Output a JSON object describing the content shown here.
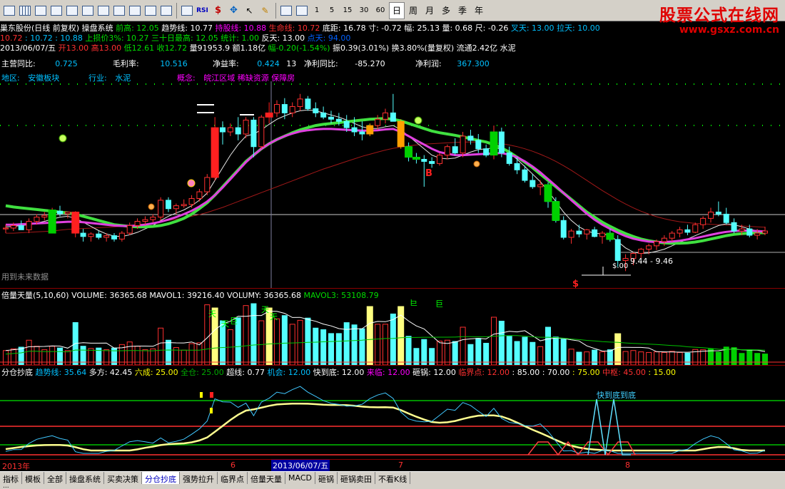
{
  "toolbar": {
    "period_buttons": [
      "1",
      "5",
      "15",
      "30",
      "60"
    ],
    "day_label": "日",
    "week_label": "周",
    "month_label": "月",
    "multi_label": "多",
    "season_label": "季",
    "year_label": "年"
  },
  "logo": {
    "title": "股票公式在线网",
    "url": "www.gsxz.com.cn"
  },
  "header": {
    "line1": [
      {
        "t": "巢东股份(日线 前复权) 操盘系统",
        "c": "#ffffff"
      },
      {
        "t": " 前高: 12.05",
        "c": "#00dd00"
      },
      {
        "t": "  趋势线: 10.77",
        "c": "#ffffff"
      },
      {
        "t": "  持股线: 10.88",
        "c": "#ff00ff"
      },
      {
        "t": "  生命线: 10.72",
        "c": "#ff3030"
      },
      {
        "t": "  底距: 16.78",
        "c": "#ffffff"
      },
      {
        "t": "  寸: -0.72",
        "c": "#ffffff"
      },
      {
        "t": "  幅: 25.13",
        "c": "#ffffff"
      },
      {
        "t": "  量: 0.68",
        "c": "#ffffff"
      },
      {
        "t": "  尺: -0.26",
        "c": "#ffffff"
      },
      {
        "t": "  叉天: 13.00",
        "c": "#00c0ff"
      },
      {
        "t": "  拉天: 10.00",
        "c": "#00c0ff"
      }
    ],
    "line2": [
      {
        "t": "  10.72",
        "c": "#ff3030"
      },
      {
        "t": " : 10.72",
        "c": "#00c0ff"
      },
      {
        "t": " : 10.88",
        "c": "#00c0ff"
      },
      {
        "t": "                               上损价3%: 10.27",
        "c": "#00dd00"
      },
      {
        "t": "  三十日最高: 12.05",
        "c": "#00dd00"
      },
      {
        "t": "  统计: 1.00",
        "c": "#00dd00"
      },
      {
        "t": "  反天: 13.00",
        "c": "#ffffff"
      },
      {
        "t": "  点天: 94.00",
        "c": "#0060ff"
      }
    ],
    "line3": [
      {
        "t": "2013/06/07/五",
        "c": "#ffffff"
      },
      {
        "t": " 开13.00",
        "c": "#ff3030"
      },
      {
        "t": " 高13.00",
        "c": "#ff3030"
      },
      {
        "t": " 低12.61",
        "c": "#00dd00"
      },
      {
        "t": " 收12.72",
        "c": "#00dd00"
      },
      {
        "t": " 量91953.9",
        "c": "#ffffff"
      },
      {
        "t": " 额1.18亿",
        "c": "#ffffff"
      },
      {
        "t": " 幅-0.20(-1.54%)",
        "c": "#00dd00"
      },
      {
        "t": " 振0.39(3.01%)",
        "c": "#ffffff"
      },
      {
        "t": " 换3.80%(量复权)",
        "c": "#ffffff"
      },
      {
        "t": " 流通2.42亿",
        "c": "#ffffff"
      },
      {
        "t": " 水泥",
        "c": "#ffffff"
      }
    ]
  },
  "fundamentals": {
    "row1": [
      {
        "label": "主营同比:",
        "value": "0.725"
      },
      {
        "label": "毛利率:",
        "value": "10.516"
      },
      {
        "label": "净益率:",
        "value": "0.424"
      },
      {
        "label": "净利同比:",
        "value": "-85.270"
      },
      {
        "label": "净利润:",
        "value": "367.300"
      }
    ],
    "mid_label": "13",
    "area_label": "地区:",
    "area_value": "安徽板块",
    "industry_label": "行业:",
    "industry_value": "水泥",
    "concept_label": "概念:",
    "concept_value": "皖江区域 稀缺资源 保障房"
  },
  "chart": {
    "b_label": "B",
    "s_label": "$",
    "s_price": "$.00",
    "range_label": "9.44 - 9.46",
    "future_label": "用到未来数据"
  },
  "volume": {
    "header": [
      {
        "t": "倍量天量(5,10,60)",
        "c": "#ffffff"
      },
      {
        "t": "  VOLUME: 36365.68",
        "c": "#ffffff"
      },
      {
        "t": "  MAVOL1: 39216.40",
        "c": "#ffffff"
      },
      {
        "t": "  VOLUMY: 36365.68",
        "c": "#ffffff"
      },
      {
        "t": "   MAVOL3: 53108.79",
        "c": "#00dd00"
      }
    ],
    "marks": [
      "天",
      "天",
      "巨",
      "天",
      "天",
      "巨",
      "巨"
    ]
  },
  "indicator": {
    "header": [
      {
        "t": "分仓抄底",
        "c": "#ffffff"
      },
      {
        "t": "  趋势线: 35.64",
        "c": "#00c0ff"
      },
      {
        "t": "     多方: 42.45",
        "c": "#ffffff"
      },
      {
        "t": "  六成: 25.00",
        "c": "#ffff00"
      },
      {
        "t": "  全仓: 25.00",
        "c": "#00aa00"
      },
      {
        "t": "      超线: 0.77",
        "c": "#ffffff"
      },
      {
        "t": "  机会: 12.00",
        "c": "#00c0ff"
      },
      {
        "t": "  快到底: 12.00",
        "c": "#ffffff"
      },
      {
        "t": "  来临: 12.00",
        "c": "#ff00ff"
      },
      {
        "t": "   砸锅: 12.00",
        "c": "#ffffff"
      },
      {
        "t": "   临界点: 12.00",
        "c": "#ff3030"
      },
      {
        "t": " : 85.00",
        "c": "#ffffff"
      },
      {
        "t": " : 70.00",
        "c": "#ffffff"
      },
      {
        "t": " : 75.00",
        "c": "#ffff00"
      },
      {
        "t": "  中枢: 45.00",
        "c": "#ff3030"
      },
      {
        "t": " : 15.00",
        "c": "#ffff00"
      }
    ],
    "bottom_label": "快到底到底"
  },
  "date_axis": {
    "year_label": "2013年",
    "m6": "6",
    "current": "2013/06/07/五",
    "m7": "7",
    "m8": "8"
  },
  "tabs": [
    "指标",
    "模板",
    "全部",
    "操盘系统",
    "买卖决策",
    "分仓抄底",
    "强势拉升",
    "临界点",
    "倍量天量",
    "MACD",
    "砸锅",
    "砸锅卖田",
    "不看K线"
  ],
  "active_tab": 5,
  "bottom_strip": "...",
  "chart_data": {
    "type": "candlestick",
    "price_range": [
      8.9,
      13.8
    ],
    "last_date": "2013/06/07",
    "candles": [
      [
        10.3,
        10.4,
        10.2,
        10.32
      ],
      [
        10.32,
        10.45,
        10.25,
        10.38
      ],
      [
        10.38,
        10.5,
        10.3,
        10.28
      ],
      [
        10.28,
        10.55,
        10.2,
        10.48
      ],
      [
        10.48,
        10.65,
        10.4,
        10.58
      ],
      [
        10.58,
        10.7,
        10.5,
        10.62
      ],
      [
        10.62,
        10.8,
        10.55,
        10.72
      ],
      [
        10.72,
        10.85,
        10.6,
        10.66
      ],
      [
        10.66,
        10.7,
        10.55,
        10.7
      ],
      [
        10.7,
        10.72,
        10.1,
        10.2
      ],
      [
        10.2,
        10.3,
        10.0,
        10.12
      ],
      [
        10.12,
        10.22,
        10.0,
        10.18
      ],
      [
        10.18,
        10.25,
        10.05,
        10.1
      ],
      [
        10.1,
        10.2,
        10.0,
        10.14
      ],
      [
        10.14,
        10.2,
        10.0,
        10.06
      ],
      [
        10.06,
        10.25,
        10.0,
        10.2
      ],
      [
        10.2,
        10.45,
        10.15,
        10.38
      ],
      [
        10.38,
        10.55,
        10.3,
        10.48
      ],
      [
        10.48,
        10.6,
        10.4,
        10.52
      ],
      [
        10.52,
        10.65,
        10.45,
        10.58
      ],
      [
        10.58,
        11.05,
        10.5,
        10.98
      ],
      [
        10.98,
        11.05,
        10.7,
        10.78
      ],
      [
        10.78,
        10.9,
        10.65,
        10.85
      ],
      [
        10.85,
        11.0,
        10.8,
        10.88
      ],
      [
        10.88,
        11.1,
        10.8,
        11.02
      ],
      [
        11.02,
        11.25,
        10.95,
        11.18
      ],
      [
        11.18,
        11.6,
        11.1,
        11.52
      ],
      [
        11.52,
        12.95,
        11.45,
        12.7
      ],
      [
        12.7,
        12.85,
        12.3,
        12.6
      ],
      [
        12.6,
        12.8,
        12.5,
        12.7
      ],
      [
        12.7,
        12.95,
        12.4,
        12.55
      ],
      [
        12.55,
        12.95,
        12.45,
        12.88
      ],
      [
        12.88,
        12.95,
        12.0,
        12.25
      ],
      [
        12.25,
        13.0,
        12.2,
        12.95
      ],
      [
        12.95,
        13.3,
        12.8,
        13.05
      ],
      [
        13.05,
        13.35,
        12.95,
        13.25
      ],
      [
        13.25,
        13.4,
        12.9,
        13.05
      ],
      [
        13.05,
        13.3,
        12.95,
        13.2
      ],
      [
        13.2,
        13.5,
        13.1,
        13.38
      ],
      [
        13.38,
        13.45,
        13.1,
        13.15
      ],
      [
        13.15,
        13.3,
        12.95,
        13.05
      ],
      [
        13.05,
        13.2,
        12.9,
        12.95
      ],
      [
        12.95,
        13.1,
        12.8,
        12.9
      ],
      [
        12.9,
        13.05,
        12.75,
        12.85
      ],
      [
        12.85,
        13.0,
        12.6,
        12.7
      ],
      [
        12.7,
        12.95,
        12.5,
        12.6
      ],
      [
        12.6,
        12.85,
        12.4,
        12.55
      ],
      [
        12.55,
        12.8,
        12.5,
        12.75
      ],
      [
        12.75,
        13.0,
        12.65,
        12.9
      ],
      [
        12.9,
        13.15,
        12.8,
        13.05
      ],
      [
        13.05,
        13.5,
        12.95,
        12.85
      ],
      [
        12.85,
        12.9,
        12.2,
        12.25
      ],
      [
        12.25,
        12.35,
        11.9,
        12.0
      ],
      [
        12.0,
        12.1,
        11.85,
        11.95
      ],
      [
        11.95,
        12.05,
        11.3,
        11.9
      ],
      [
        11.9,
        12.0,
        11.75,
        11.85
      ],
      [
        11.85,
        12.1,
        11.8,
        12.05
      ],
      [
        12.05,
        12.3,
        11.95,
        12.25
      ],
      [
        12.25,
        12.45,
        12.05,
        12.1
      ],
      [
        12.1,
        12.6,
        12.0,
        12.5
      ],
      [
        12.5,
        12.65,
        12.3,
        12.4
      ],
      [
        12.4,
        12.55,
        12.1,
        12.2
      ],
      [
        12.2,
        12.3,
        12.0,
        12.05
      ],
      [
        12.05,
        12.75,
        11.95,
        12.6
      ],
      [
        12.6,
        12.7,
        12.0,
        12.1
      ],
      [
        12.1,
        12.25,
        11.8,
        11.85
      ],
      [
        11.85,
        12.0,
        11.6,
        11.7
      ],
      [
        11.7,
        11.8,
        11.4,
        11.45
      ],
      [
        11.45,
        11.6,
        11.25,
        11.3
      ],
      [
        11.3,
        11.45,
        11.1,
        11.35
      ],
      [
        11.35,
        11.4,
        10.8,
        10.95
      ],
      [
        10.95,
        11.05,
        10.45,
        10.5
      ],
      [
        10.5,
        10.6,
        10.05,
        10.1
      ],
      [
        10.1,
        10.3,
        9.95,
        10.25
      ],
      [
        10.25,
        10.4,
        10.1,
        10.18
      ],
      [
        10.18,
        10.3,
        10.05,
        10.28
      ],
      [
        10.28,
        10.35,
        10.1,
        10.12
      ],
      [
        10.12,
        10.25,
        9.95,
        10.2
      ],
      [
        10.2,
        10.3,
        10.0,
        10.05
      ],
      [
        10.05,
        10.15,
        9.4,
        9.55
      ],
      [
        9.55,
        9.7,
        9.3,
        9.6
      ],
      [
        9.6,
        9.75,
        9.44,
        9.72
      ],
      [
        9.72,
        9.85,
        9.6,
        9.82
      ],
      [
        9.82,
        9.95,
        9.7,
        9.9
      ],
      [
        9.9,
        10.05,
        9.8,
        10.0
      ],
      [
        10.0,
        10.15,
        9.9,
        10.08
      ],
      [
        10.08,
        10.25,
        10.0,
        10.2
      ],
      [
        10.2,
        10.35,
        10.1,
        10.28
      ],
      [
        10.28,
        10.4,
        10.15,
        10.22
      ],
      [
        10.22,
        10.45,
        10.2,
        10.4
      ],
      [
        10.4,
        10.6,
        10.3,
        10.55
      ],
      [
        10.55,
        10.8,
        10.45,
        10.7
      ],
      [
        10.7,
        10.95,
        10.6,
        10.65
      ],
      [
        10.65,
        10.8,
        10.4,
        10.45
      ],
      [
        10.45,
        10.55,
        10.2,
        10.25
      ],
      [
        10.25,
        10.4,
        10.15,
        10.3
      ],
      [
        10.3,
        10.4,
        10.1,
        10.15
      ],
      [
        10.15,
        10.3,
        10.05,
        10.2
      ],
      [
        10.2,
        10.35,
        10.15,
        10.25
      ]
    ],
    "special_candles": {
      "red_wide": [
        9,
        27,
        34
      ],
      "orange_wide": [
        47,
        51
      ]
    },
    "ma_green": [
      10.85,
      10.82,
      10.8,
      10.78,
      10.76,
      10.74,
      10.72,
      10.7,
      10.68,
      10.65,
      10.6,
      10.55,
      10.5,
      10.45,
      10.4,
      10.38,
      10.36,
      10.35,
      10.35,
      10.36,
      10.38,
      10.42,
      10.48,
      10.55,
      10.65,
      10.78,
      10.92,
      11.1,
      11.3,
      11.5,
      11.7,
      11.9,
      12.05,
      12.2,
      12.32,
      12.42,
      12.5,
      12.58,
      12.65,
      12.7,
      12.75,
      12.78,
      12.8,
      12.82,
      12.84,
      12.86,
      12.88,
      12.9,
      12.91,
      12.92,
      12.9,
      12.86,
      12.8,
      12.74,
      12.68,
      12.62,
      12.58,
      12.55,
      12.52,
      12.48,
      12.44,
      12.4,
      12.36,
      12.3,
      12.22,
      12.12,
      12.0,
      11.88,
      11.75,
      11.6,
      11.45,
      11.3,
      11.15,
      11.0,
      10.85,
      10.7,
      10.58,
      10.46,
      10.36,
      10.27,
      10.19,
      10.12,
      10.06,
      10.02,
      9.99,
      9.97,
      9.96,
      9.96,
      9.97,
      9.99,
      10.02,
      10.06,
      10.1,
      10.14,
      10.17,
      10.19,
      10.2,
      10.21,
      10.21
    ],
    "ma_magenta": [
      10.4,
      10.4,
      10.41,
      10.42,
      10.43,
      10.44,
      10.45,
      10.46,
      10.47,
      10.47,
      10.46,
      10.44,
      10.42,
      10.4,
      10.38,
      10.37,
      10.37,
      10.38,
      10.4,
      10.43,
      10.47,
      10.52,
      10.58,
      10.65,
      10.73,
      10.83,
      10.95,
      11.1,
      11.28,
      11.48,
      11.68,
      11.88,
      12.05,
      12.2,
      12.32,
      12.42,
      12.5,
      12.56,
      12.61,
      12.64,
      12.66,
      12.67,
      12.67,
      12.66,
      12.65,
      12.64,
      12.63,
      12.63,
      12.64,
      12.66,
      12.67,
      12.6,
      12.5,
      12.4,
      12.3,
      12.2,
      12.12,
      12.08,
      12.05,
      12.05,
      12.06,
      12.07,
      12.08,
      12.09,
      12.1,
      12.06,
      12.0,
      11.9,
      11.78,
      11.64,
      11.48,
      11.32,
      11.15,
      10.98,
      10.82,
      10.66,
      10.52,
      10.4,
      10.3,
      10.21,
      10.13,
      10.07,
      10.03,
      10.0,
      9.99,
      9.99,
      10.0,
      10.02,
      10.05,
      10.08,
      10.12,
      10.16,
      10.2,
      10.23,
      10.25,
      10.26,
      10.26,
      10.25,
      10.24
    ],
    "ma_white": [
      10.35,
      10.36,
      10.38,
      10.4,
      10.44,
      10.48,
      10.53,
      10.58,
      10.6,
      10.55,
      10.46,
      10.36,
      10.26,
      10.18,
      10.13,
      10.12,
      10.16,
      10.22,
      10.3,
      10.38,
      10.5,
      10.6,
      10.68,
      10.75,
      10.85,
      10.98,
      11.15,
      11.45,
      11.75,
      12.05,
      12.3,
      12.5,
      12.55,
      12.65,
      12.78,
      12.9,
      12.98,
      13.05,
      13.1,
      13.12,
      13.1,
      13.05,
      13.0,
      12.95,
      12.88,
      12.8,
      12.72,
      12.68,
      12.68,
      12.72,
      12.75,
      12.65,
      12.5,
      12.35,
      12.2,
      12.05,
      11.98,
      11.96,
      11.98,
      12.05,
      12.12,
      12.18,
      12.2,
      12.22,
      12.2,
      12.1,
      11.95,
      11.78,
      11.6,
      11.42,
      11.2,
      10.95,
      10.7,
      10.5,
      10.35,
      10.25,
      10.2,
      10.18,
      10.15,
      10.0,
      9.85,
      9.75,
      9.72,
      9.73,
      9.77,
      9.82,
      9.9,
      9.98,
      10.06,
      10.14,
      10.22,
      10.3,
      10.38,
      10.42,
      10.4,
      10.35,
      10.3,
      10.25,
      10.22
    ],
    "ma_darkred": [
      10.2,
      10.2,
      10.21,
      10.22,
      10.23,
      10.24,
      10.25,
      10.27,
      10.29,
      10.3,
      10.31,
      10.32,
      10.33,
      10.34,
      10.35,
      10.36,
      10.38,
      10.4,
      10.42,
      10.44,
      10.47,
      10.5,
      10.53,
      10.56,
      10.6,
      10.64,
      10.69,
      10.75,
      10.81,
      10.88,
      10.95,
      11.02,
      11.09,
      11.16,
      11.23,
      11.3,
      11.37,
      11.44,
      11.51,
      11.58,
      11.65,
      11.72,
      11.78,
      11.84,
      11.9,
      11.96,
      12.02,
      12.07,
      12.12,
      12.17,
      12.21,
      12.24,
      12.27,
      12.29,
      12.31,
      12.32,
      12.33,
      12.34,
      12.35,
      12.36,
      12.36,
      12.36,
      12.35,
      12.34,
      12.32,
      12.29,
      12.25,
      12.2,
      12.14,
      12.07,
      11.99,
      11.9,
      11.8,
      11.69,
      11.57,
      11.45,
      11.33,
      11.21,
      11.1,
      10.99,
      10.89,
      10.8,
      10.72,
      10.65,
      10.59,
      10.54,
      10.5,
      10.47,
      10.45,
      10.43,
      10.42,
      10.41,
      10.4,
      10.39,
      10.38,
      10.37,
      10.36,
      10.35,
      10.34
    ]
  }
}
